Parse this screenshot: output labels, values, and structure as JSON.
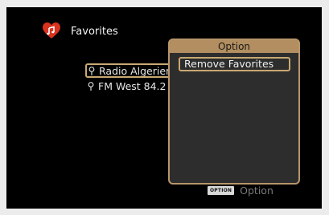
{
  "header": {
    "icon": "heart-music-icon",
    "title": "Favorites"
  },
  "favorites": {
    "items": [
      {
        "label": "Radio Algerienne Jil FM",
        "icon": "map-pin-icon",
        "selected": true
      },
      {
        "label": "FM West 84.2",
        "icon": "map-pin-icon",
        "selected": false
      }
    ]
  },
  "option_menu": {
    "title": "Option",
    "items": [
      {
        "label": "Remove Favorites",
        "selected": true
      }
    ]
  },
  "footer": {
    "key_label": "OPTION",
    "action_label": "Option"
  },
  "colors": {
    "accent_gold": "#c9a872",
    "header_gold": "#b28e60",
    "panel_bg": "#2d2d2d",
    "screen_bg": "#000000",
    "heart_red": "#d9321f"
  }
}
